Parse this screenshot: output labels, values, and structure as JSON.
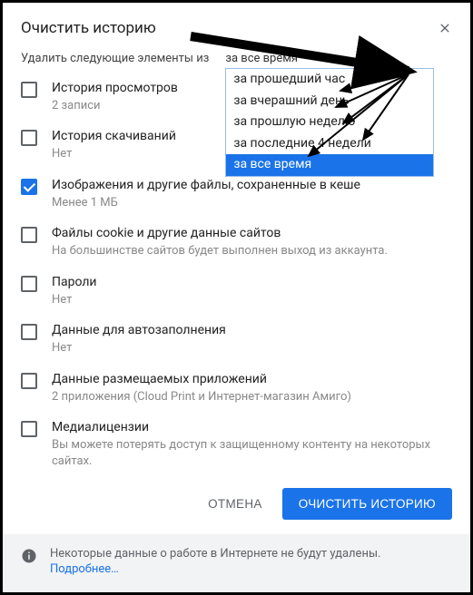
{
  "title": "Очистить историю",
  "deleteLabel": "Удалить следующие элементы из",
  "timeRange": {
    "selected": "за все время",
    "options": [
      "за прошедший час",
      "за вчерашний день",
      "за прошлую неделю",
      "за последние 4 недели",
      "за все время"
    ]
  },
  "items": [
    {
      "title": "История просмотров",
      "sub": "2 записи",
      "checked": false
    },
    {
      "title": "История скачиваний",
      "sub": "Нет",
      "checked": false
    },
    {
      "title": "Изображения и другие файлы, сохраненные в кеше",
      "sub": "Менее 1 МБ",
      "checked": true
    },
    {
      "title": "Файлы cookie и другие данные сайтов",
      "sub": "На большинстве сайтов будет выполнен выход из аккаунта.",
      "checked": false
    },
    {
      "title": "Пароли",
      "sub": "Нет",
      "checked": false
    },
    {
      "title": "Данные для автозаполнения",
      "sub": "Нет",
      "checked": false
    },
    {
      "title": "Данные размещаемых приложений",
      "sub": "2 приложения (Cloud Print и Интернет-магазин Амиго)",
      "checked": false
    },
    {
      "title": "Медиалицензии",
      "sub": "Вы можете потерять доступ к защищенному контенту на некоторых сайтах.",
      "checked": false
    }
  ],
  "actions": {
    "cancel": "ОТМЕНА",
    "clear": "ОЧИСТИТЬ ИСТОРИЮ"
  },
  "footer": {
    "text": "Некоторые данные о работе в Интернете не будут удалены.",
    "link": "Подробнее…"
  }
}
